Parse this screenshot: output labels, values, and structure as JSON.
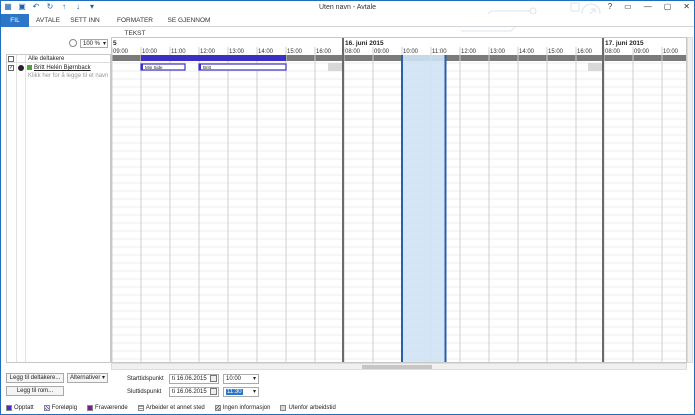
{
  "window": {
    "title": "Uten navn  -  Avtale",
    "help": "?",
    "minimize": "—",
    "restore": "▢",
    "close": "✕"
  },
  "qat": [
    "calendar-app-icon",
    "save-icon",
    "undo-icon",
    "redo-icon",
    "up-icon",
    "down-icon",
    "more-icon"
  ],
  "ribbon": {
    "tabs": [
      "FIL",
      "AVTALE",
      "SETT INN",
      "FORMATER TEKST",
      "SE GJENNOM"
    ]
  },
  "zoom": {
    "value": "100 %"
  },
  "days": [
    {
      "label": "5",
      "times": [
        "09:00",
        "10:00",
        "11:00",
        "12:00",
        "13:00",
        "14:00",
        "15:00",
        "16:00"
      ]
    },
    {
      "label": "16. juni 2015",
      "times": [
        "08:00",
        "09:00",
        "10:00",
        "11:00",
        "12:00",
        "13:00",
        "14:00",
        "15:00",
        "16:00"
      ]
    },
    {
      "label": "17. juni 2015",
      "times": [
        "08:00",
        "09:00",
        "10:00"
      ]
    }
  ],
  "attendees": {
    "header": "Alle deltakere",
    "rows": [
      {
        "name": "Britt Helén Bjørnback"
      }
    ],
    "add_hint": "Klikk her for å legge til et navn"
  },
  "busy_blocks": [
    {
      "label": "Min Side"
    },
    {
      "label": "Britt"
    }
  ],
  "buttons": {
    "add_attendees": "Legg til deltakere...",
    "options": "Alternativer",
    "add_room": "Legg til rom..."
  },
  "start": {
    "label": "Starttidspunkt",
    "date": "ti 16.06.2015",
    "time": "10:00"
  },
  "end": {
    "label": "Sluttidspunkt",
    "date": "ti 16.06.2015",
    "time": "11:30"
  },
  "legend": [
    {
      "label": "Opptatt",
      "color": "#4b2fbf"
    },
    {
      "label": "Foreløpig",
      "color": "#ffffff"
    },
    {
      "label": "Fraværende",
      "color": "#7a1e8c"
    },
    {
      "label": "Arbeider et annet sted",
      "color": "#ffffff"
    },
    {
      "label": "Ingen informasjon",
      "color": "#ffffff"
    },
    {
      "label": "Utenfor arbeidstid",
      "color": "#d8d8d8"
    }
  ],
  "colors": {
    "accent": "#2b76c6",
    "selection": "#cfe3f4",
    "selection_border": "#2a60a8",
    "busy": "#3d2fc4"
  }
}
